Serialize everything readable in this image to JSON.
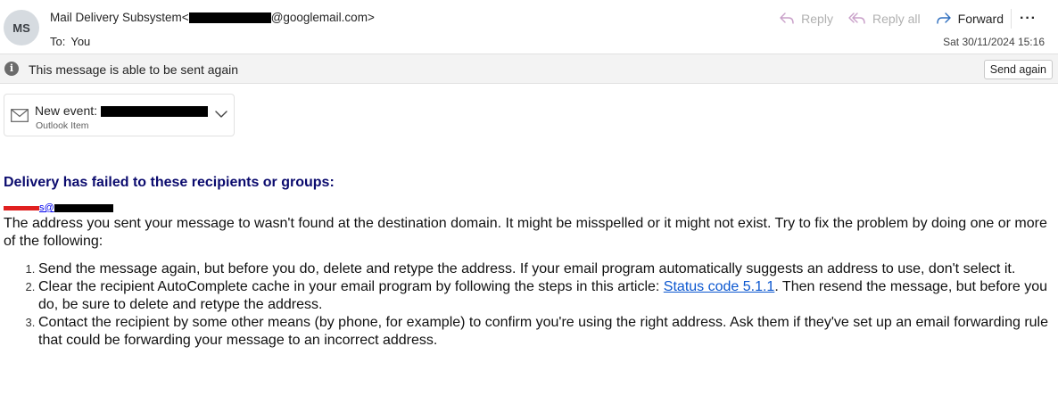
{
  "header": {
    "avatar_initials": "MS",
    "sender_name": "Mail Delivery Subsystem",
    "sender_email_prefix": "<",
    "sender_email_suffix": "@googlemail.com>",
    "to_label": "To:",
    "to_value": "You",
    "date": "Sat 30/11/2024 15:16"
  },
  "actions": {
    "reply": "Reply",
    "reply_all": "Reply all",
    "forward": "Forward",
    "more": "···"
  },
  "infobar": {
    "text": "This message is able to be sent again",
    "button": "Send again"
  },
  "attachment": {
    "title_prefix": "New event: ",
    "subtitle": "Outlook Item"
  },
  "message": {
    "heading": "Delivery has failed to these recipients or groups:",
    "recipient_visible": "s@",
    "paragraph": "The address you sent your message to wasn't found at the destination domain. It might be misspelled or it might not exist. Try to fix the problem by doing one or more of the following:",
    "steps": [
      "Send the message again, but before you do, delete and retype the address. If your email program automatically suggests an address to use, don't select it.",
      {
        "before": "Clear the recipient AutoComplete cache in your email program by following the steps in this article: ",
        "link": "Status code 5.1.1",
        "after": ". Then resend the message, but before you do, be sure to delete and retype the address."
      },
      "Contact the recipient by some other means (by phone, for example) to confirm you're using the right address. Ask them if they've set up an email forwarding rule that could be forwarding your message to an incorrect address."
    ]
  },
  "colors": {
    "heading": "#0b0b6e",
    "link": "#0b57d0",
    "forward_icon": "#2f6fbf",
    "disabled": "#b0b0b0"
  },
  "icons": {
    "reply": "reply-arrow-icon",
    "reply_all": "reply-all-arrow-icon",
    "forward": "forward-arrow-icon",
    "info": "info-icon",
    "attachment": "envelope-icon",
    "expand": "chevron-down-icon"
  }
}
